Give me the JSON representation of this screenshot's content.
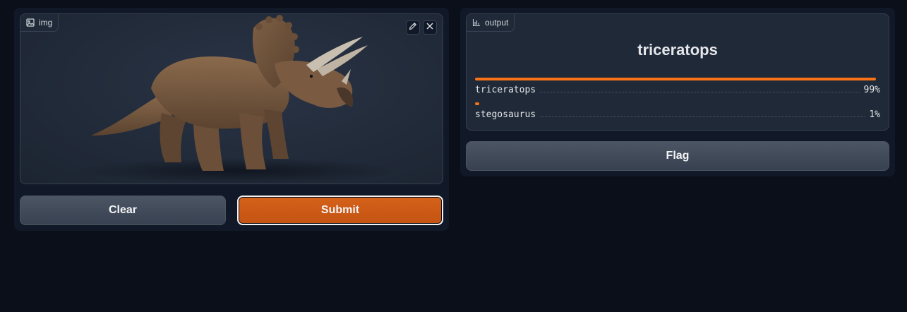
{
  "input": {
    "label": "img"
  },
  "buttons": {
    "clear": "Clear",
    "submit": "Submit",
    "flag": "Flag"
  },
  "output": {
    "label": "output",
    "predicted": "triceratops",
    "confidences": [
      {
        "label": "triceratops",
        "percent_text": "99%",
        "value": 0.99
      },
      {
        "label": "stegosaurus",
        "percent_text": "1%",
        "value": 0.01
      }
    ]
  },
  "colors": {
    "accent": "#f97316",
    "submit": "#c55312",
    "background": "#0b0f19",
    "panel": "#111827"
  },
  "icons": [
    "image-icon",
    "pencil-icon",
    "close-icon",
    "bar-chart-icon"
  ]
}
